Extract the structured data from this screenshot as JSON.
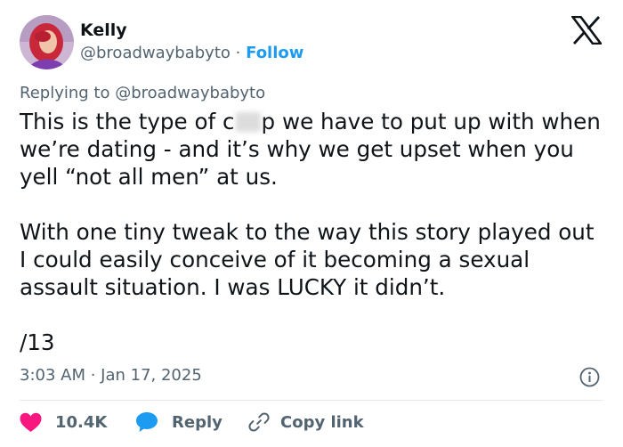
{
  "author": {
    "name": "Kelly",
    "handle": "@broadwaybabyto",
    "separator": "·",
    "follow_label": "Follow"
  },
  "reply_context": {
    "prefix": "Replying to",
    "mention": "@broadwaybabyto"
  },
  "tweet": {
    "paragraph1_before": "This is the type of c",
    "paragraph1_after": "p we have to put up with when we’re dating - and it’s why we get upset when you yell “not all men” at us.",
    "paragraph2": "With one tiny tweak to the way this story played out I could easily conceive of it becoming a sexual assault situation. I was LUCKY it didn’t.",
    "paragraph3": "/13"
  },
  "timestamp": "3:03 AM · Jan 17, 2025",
  "actions": {
    "likes_count": "10.4K",
    "reply_label": "Reply",
    "copy_link_label": "Copy link"
  },
  "icons": {
    "logo": "x-logo-icon",
    "info": "info-icon",
    "like": "heart-icon",
    "reply": "speech-bubble-icon",
    "copy": "link-icon"
  },
  "colors": {
    "text": "#0f1419",
    "secondary": "#536471",
    "accent": "#1d9bf0",
    "like": "#f91880"
  }
}
